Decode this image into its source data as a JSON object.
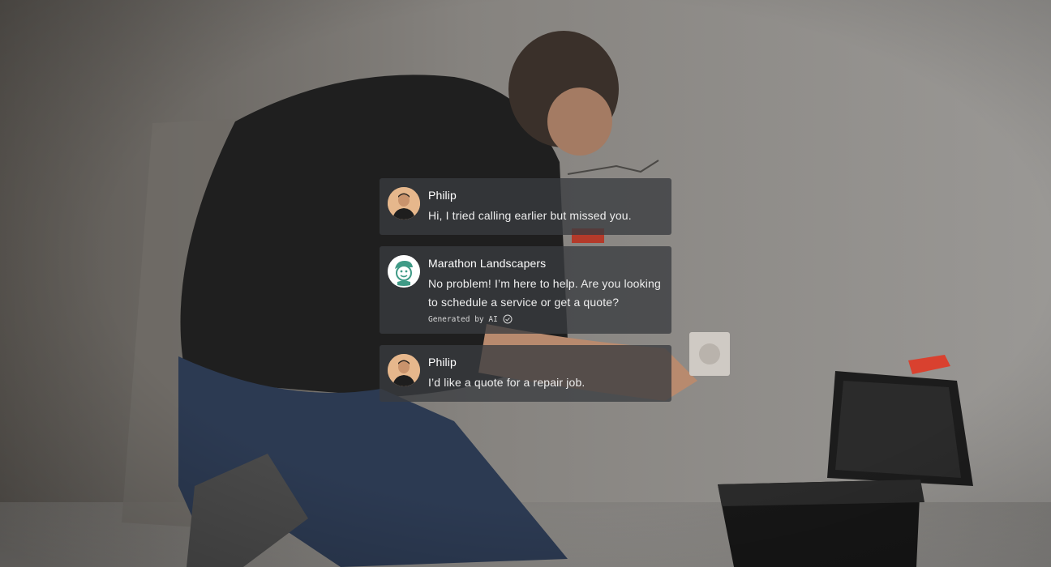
{
  "messages": [
    {
      "sender": "Philip",
      "text": "Hi, I tried calling earlier but missed you.",
      "avatar": "user-avatar"
    },
    {
      "sender": "Marathon Landscapers",
      "text": "No problem! I’m here to help. Are you looking to schedule a service or get a quote?",
      "avatar": "brand-avatar",
      "badge": "Generated by AI",
      "badge_icon": "check-circle-icon"
    },
    {
      "sender": "Philip",
      "text": "I’d like a quote for a repair job.",
      "avatar": "user-avatar"
    }
  ],
  "colors": {
    "bubble_bg": "#3a3c40",
    "brand_green": "#3f9a86",
    "text": "#ffffff"
  }
}
